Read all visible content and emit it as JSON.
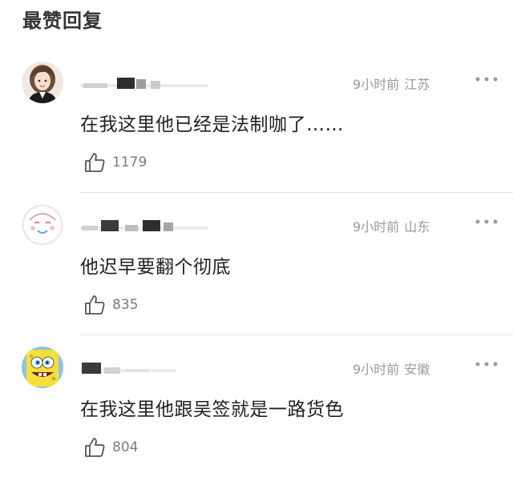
{
  "section_title": "最赞回复",
  "comments": [
    {
      "time": "9小时前",
      "location": "江苏",
      "text": "在我这里他已经是法制咖了……",
      "likes": "1179",
      "avatar": "portrait-avatar"
    },
    {
      "time": "9小时前",
      "location": "山东",
      "text": "他迟早要翻个彻底",
      "likes": "835",
      "avatar": "cartoon-face-avatar"
    },
    {
      "time": "9小时前",
      "location": "安徽",
      "text": "在我这里他跟吴签就是一路货色",
      "likes": "804",
      "avatar": "spongebob-avatar"
    }
  ],
  "icons": {
    "like": "thumbs-up-icon",
    "more": "more-dots-icon"
  },
  "colors": {
    "meta_text": "#9a9a9a",
    "divider": "#e6e6e6",
    "like_count": "#7a7a7a"
  }
}
